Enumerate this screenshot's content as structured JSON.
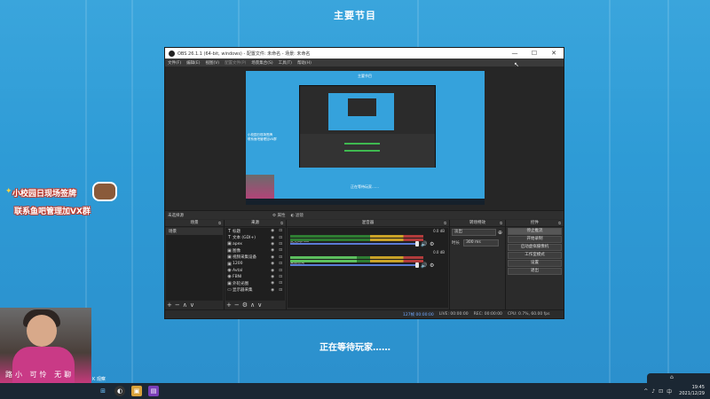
{
  "scene": {
    "title": "主要节目",
    "waiting": "正在等待玩家……",
    "promo_line1": "小校园日现场签牌",
    "promo_line2": "联系鱼吧管理加VX群",
    "webcam_ticker": "路小 可怜 无聊",
    "webcam_tag": "K 观察"
  },
  "obs": {
    "window_title": "OBS 26.1.1 (64-bit, windows) - 配置文件: 未命名 - 场景: 未命名",
    "window_controls": [
      "—",
      "☐",
      "✕"
    ],
    "menu": [
      "文件(F)",
      "编辑(E)",
      "视图(V)",
      "配置文件(P)",
      "场景集合(S)",
      "工具(T)",
      "帮助(H)"
    ],
    "preview_text_top": "主要节目",
    "preview_text_bottom": "正在等待玩家……",
    "preview_bubble_line1": "小校园日现场签牌",
    "preview_bubble_line2": "联系鱼吧管理加VX群",
    "subbar": {
      "no_source": "未选择源",
      "properties": "属性",
      "filters": "滤镜"
    },
    "scenes": {
      "title": "场景",
      "items": [
        "场景"
      ]
    },
    "sources": {
      "title": "来源",
      "items": [
        {
          "icon": "T",
          "label": "标题"
        },
        {
          "icon": "T",
          "label": "文本 (GDI+)"
        },
        {
          "icon": "▣",
          "label": "apex"
        },
        {
          "icon": "▣",
          "label": "图像"
        },
        {
          "icon": "▣",
          "label": "视频采集设备"
        },
        {
          "icon": "▣",
          "label": "1200"
        },
        {
          "icon": "◉",
          "label": "Avtal"
        },
        {
          "icon": "◉",
          "label": "FBNI"
        },
        {
          "icon": "▣",
          "label": "外轮光圈"
        },
        {
          "icon": "▭",
          "label": "显示器采集"
        }
      ]
    },
    "mixer": {
      "title": "混音器",
      "channels": [
        {
          "name": "麦克风/Aux",
          "db": "0.0 dB"
        },
        {
          "name": "桌面音频",
          "db": "0.0 dB"
        }
      ]
    },
    "transitions": {
      "title": "转场特效",
      "selected": "淡出",
      "duration_label": "时长",
      "duration_value": "300 ms"
    },
    "controls": {
      "title": "控件",
      "buttons": [
        "停止推流",
        "开始录制",
        "启动虚拟摄像机",
        "工作室模式",
        "设置",
        "退出"
      ]
    },
    "status": {
      "drop": "127帧 00:00:00",
      "live": "LIVE: 00:00:00",
      "rec": "REC: 00:00:00",
      "cpu": "CPU: 0.7%, 60.00 fps"
    }
  },
  "taskbar": {
    "icons": [
      "⊞",
      "⌕",
      "◐",
      "▣",
      "▤"
    ],
    "tray": [
      "^",
      "♪",
      "⊡",
      "中"
    ],
    "time": "19:45",
    "date": "2021/12/29"
  },
  "colors": {
    "background": "#2e9bd6",
    "obs_dark": "#2b2b2b",
    "meter_green": "#2e7d32",
    "meter_yellow": "#c9a227",
    "meter_red": "#b23b3b",
    "taskbar": "#1b2733"
  }
}
